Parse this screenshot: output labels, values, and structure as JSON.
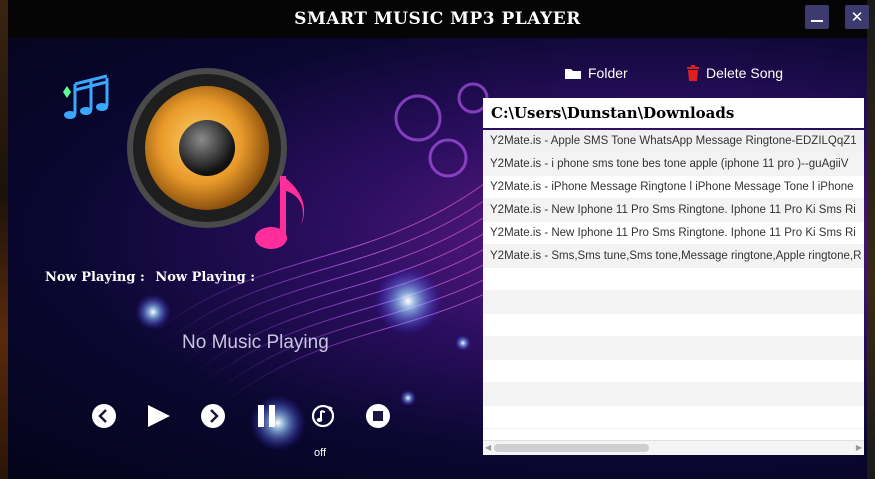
{
  "window": {
    "title": "SMART MUSIC MP3 PLAYER",
    "minimize_icon": "minimize-icon",
    "close_icon": "close-icon",
    "close_glyph": "✕"
  },
  "colors": {
    "window_button_bg": "#3d3a6e",
    "accent_purple": "#6a1e8c",
    "delete_red": "#e02020",
    "speaker_orange": "#e89a2a",
    "note_pink": "#ff2e9a",
    "note_blue": "#3aa8ff"
  },
  "player": {
    "now_playing_label": "Now Playing :",
    "now_playing_value": "Now Playing :",
    "status_text": "No Music Playing",
    "repeat_state": "off",
    "controls": [
      {
        "name": "previous",
        "icon": "previous-icon"
      },
      {
        "name": "play",
        "icon": "play-icon"
      },
      {
        "name": "next",
        "icon": "next-icon"
      },
      {
        "name": "pause",
        "icon": "pause-icon"
      },
      {
        "name": "repeat",
        "icon": "repeat-icon"
      },
      {
        "name": "stop",
        "icon": "stop-icon"
      }
    ]
  },
  "toolbar": {
    "folder_label": "Folder",
    "folder_icon": "folder-icon",
    "delete_label": "Delete Song",
    "delete_icon": "trash-icon"
  },
  "path": "C:\\Users\\Dunstan\\Downloads",
  "songs": [
    "Y2Mate.is - Apple SMS Tone  WhatsApp Message Ringtone-EDZILQqZ1",
    "Y2Mate.is - i phone sms tone bes tone apple (iphone 11 pro )--guAgiiV",
    "Y2Mate.is - iPhone Message Ringtone l iPhone Message Tone l iPhone",
    "Y2Mate.is - New Iphone 11 Pro Sms Ringtone. Iphone 11 Pro Ki Sms Ri",
    "Y2Mate.is - New Iphone 11 Pro Sms Ringtone. Iphone 11 Pro Ki Sms Ri",
    "Y2Mate.is - Sms,Sms tune,Sms tone,Message ringtone,Apple ringtone,R"
  ]
}
